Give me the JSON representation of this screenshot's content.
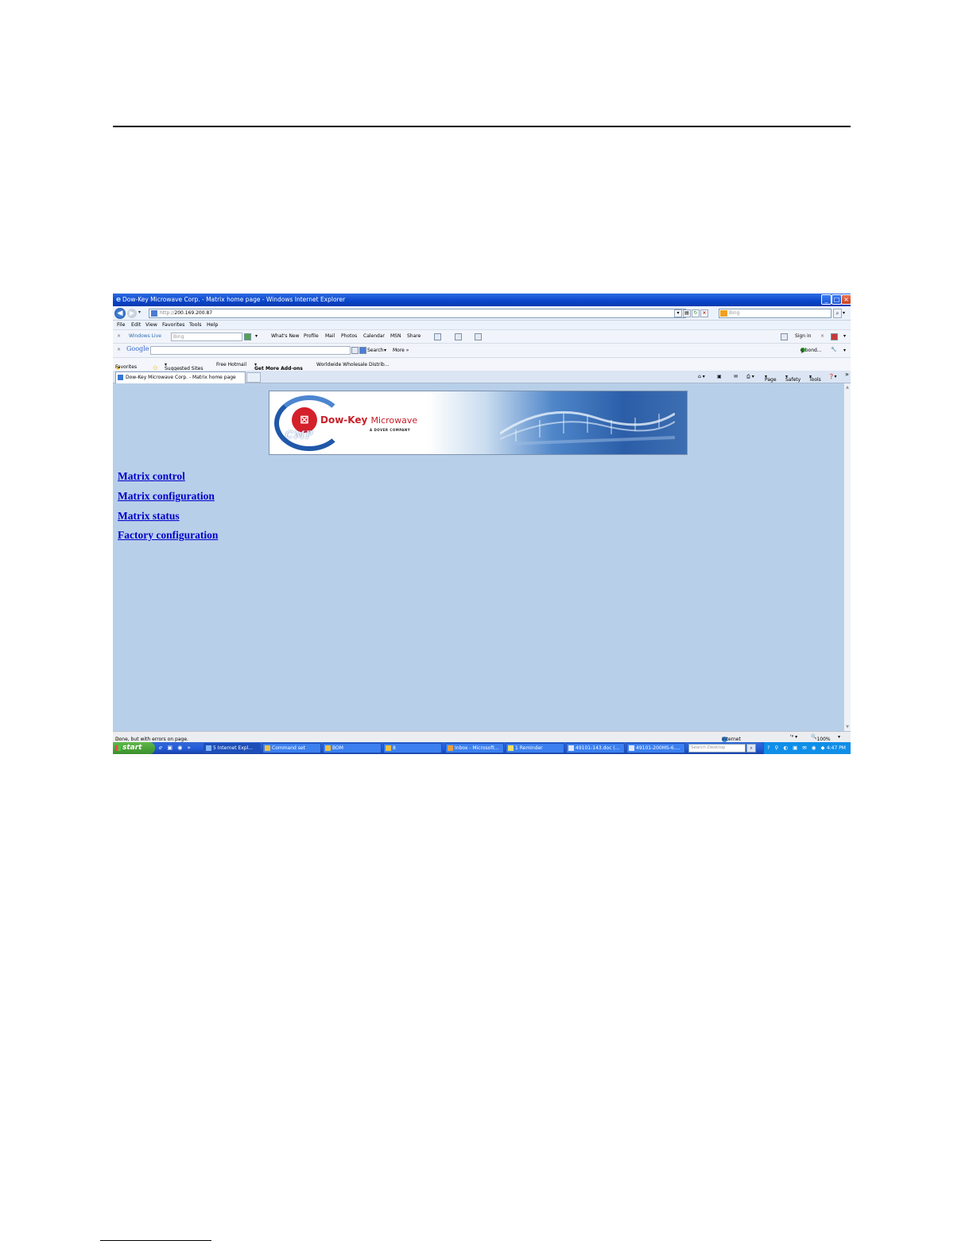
{
  "window": {
    "title": "Dow-Key Microwave Corp. - Matrix home page - Windows Internet Explorer"
  },
  "address_bar": {
    "url_prefix": "http://",
    "url": "200.169.200.87",
    "search_placeholder": "Bing"
  },
  "menu": [
    "File",
    "Edit",
    "View",
    "Favorites",
    "Tools",
    "Help"
  ],
  "windows_live_toolbar": {
    "brand": "Windows Live",
    "search_placeholder": "Bing",
    "links": [
      "What's New",
      "Profile",
      "Mail",
      "Photos",
      "Calendar",
      "MSN",
      "Share"
    ],
    "sign_in": "Sign in"
  },
  "google_toolbar": {
    "brand": "Google",
    "search_button": "Search",
    "more": "More »",
    "account": "g bond..."
  },
  "favorites_bar": {
    "favorites": "Favorites",
    "items": [
      "Suggested Sites",
      "Free Hotmail",
      "Get More Add-ons",
      "Worldwide Wholesale Distrib..."
    ]
  },
  "tab": {
    "title": "Dow-Key Microwave Corp. - Matrix home page"
  },
  "command_bar": [
    "Page",
    "Safety",
    "Tools"
  ],
  "banner": {
    "brand": "Dow-Key",
    "brand_suffix": "Microwave",
    "tagline": "A DOVER COMPANY",
    "monogram": "CMP"
  },
  "links": [
    "Matrix control",
    "Matrix configuration",
    "Matrix status",
    "Factory configuration"
  ],
  "status_bar": {
    "message": "Done, but with errors on page.",
    "zone": "Internet",
    "zoom": "100%"
  },
  "taskbar": {
    "start": "start",
    "items": [
      "5 Internet Expl...",
      "Command set",
      "BOM",
      "8",
      "Inbox - Microsoft...",
      "1 Reminder",
      "49101-143.doc (...",
      "49101-200MS-6...."
    ],
    "search_placeholder": "Search Desktop",
    "clock": "4:47 PM"
  },
  "colors": {
    "page_bg": "#b8cfe9",
    "link": "#0000cc",
    "titlebar": "#0a45c9",
    "taskbar": "#245dda",
    "start": "#3a8f2b"
  }
}
